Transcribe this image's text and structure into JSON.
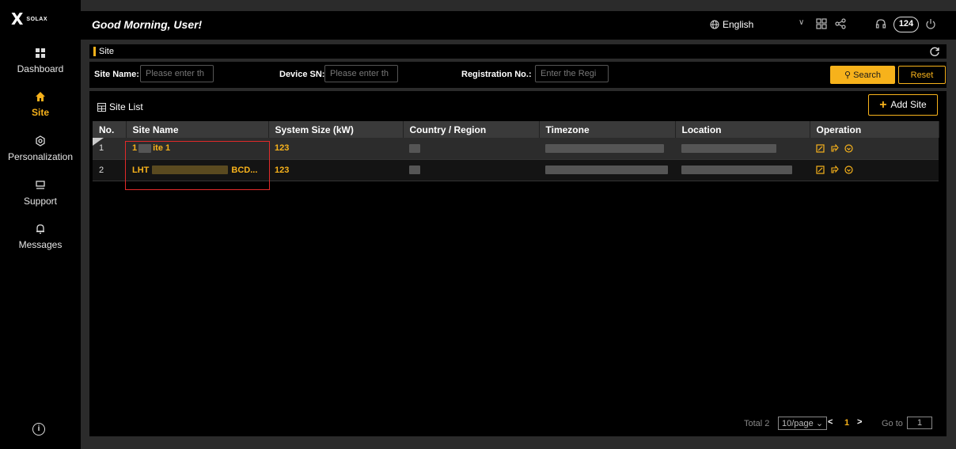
{
  "sidebar": {
    "logo": {
      "mark": "X",
      "text": "SOLAX"
    },
    "items": [
      {
        "label": "Dashboard",
        "icon": "dashboard-icon"
      },
      {
        "label": "Site",
        "icon": "home-icon",
        "active": true
      },
      {
        "label": "Personalization",
        "icon": "gear-icon"
      },
      {
        "label": "Support",
        "icon": "support-icon"
      },
      {
        "label": "Messages",
        "icon": "bell-icon"
      }
    ],
    "info_icon": "i"
  },
  "header": {
    "greeting": "Good Morning, User!",
    "language": "English",
    "language_chevron": "∨",
    "notification_count": "124"
  },
  "breadcrumb": {
    "title": "Site"
  },
  "filters": {
    "site_name_label": "Site Name:",
    "site_name_placeholder": "Please enter th",
    "device_sn_label": "Device SN:",
    "device_sn_placeholder": "Please enter th",
    "registration_label": "Registration No.:",
    "registration_placeholder": "Enter the Regi",
    "search_label": "Search",
    "reset_label": "Reset"
  },
  "site_list": {
    "title": "Site List",
    "add_label": "Add Site",
    "columns": [
      "No.",
      "Site Name",
      "System Size (kW)",
      "Country / Region",
      "Timezone",
      "Location",
      "Operation"
    ],
    "rows": [
      {
        "no": "1",
        "site_name_start": "1",
        "site_name_end": "ite 1",
        "system_size": "123"
      },
      {
        "no": "2",
        "site_name_start": "LHT",
        "site_name_end": "BCD...",
        "system_size": "123"
      }
    ]
  },
  "pagination": {
    "total": "Total 2",
    "page_size": "10/page",
    "current_page": "1",
    "goto_label": "Go to",
    "goto_value": "1"
  },
  "colors": {
    "accent": "#f7b21b",
    "highlight_box": "#e12a2a"
  }
}
